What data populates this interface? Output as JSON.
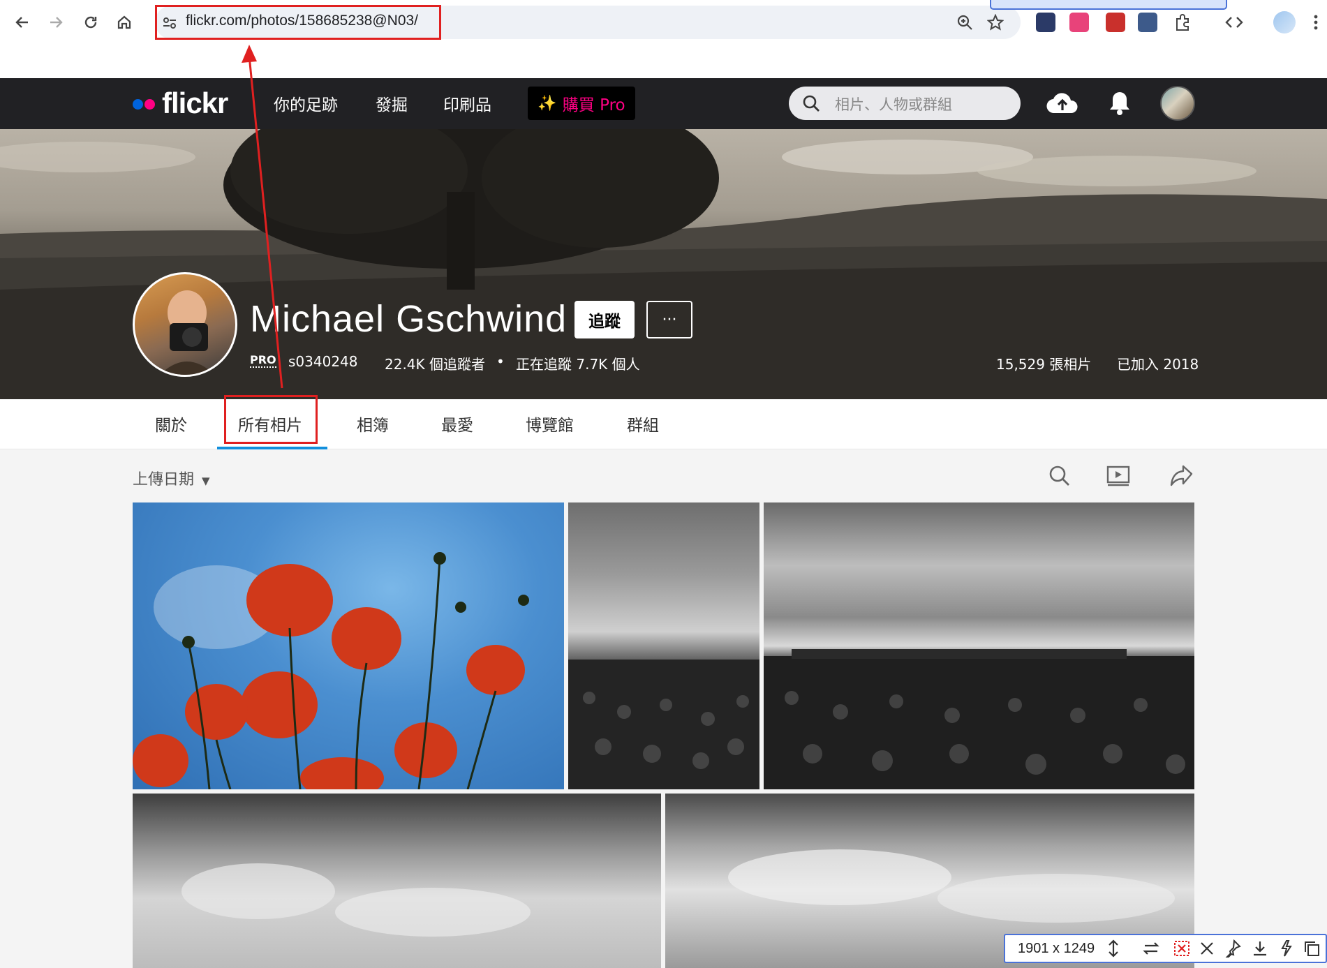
{
  "browser": {
    "url": "flickr.com/photos/158685238@N03/"
  },
  "flickr_nav": {
    "logo": "flickr",
    "links": [
      "你的足跡",
      "發掘",
      "印刷品"
    ],
    "pro_label": "購買 Pro",
    "search_placeholder": "相片、人物或群組"
  },
  "profile": {
    "name": "Michael Gschwind",
    "follow_label": "追蹤",
    "more_label": "···",
    "pro_badge": "PRO",
    "username": "s0340248",
    "followers": "22.4K 個追蹤者",
    "following": "正在追蹤 7.7K 個人",
    "separator": "•",
    "photo_count": "15,529 張相片",
    "joined": "已加入 2018"
  },
  "tabs": [
    "關於",
    "所有相片",
    "相簿",
    "最愛",
    "博覽館",
    "群組"
  ],
  "active_tab": "所有相片",
  "toolbar": {
    "sort_label": "上傳日期"
  },
  "capture_tool": {
    "size_label": "1901 x 1249"
  },
  "colors": {
    "flickr_blue": "#0063dc",
    "flickr_pink": "#ff0084",
    "tab_active": "#128fdc",
    "annotation_red": "#e02020"
  }
}
